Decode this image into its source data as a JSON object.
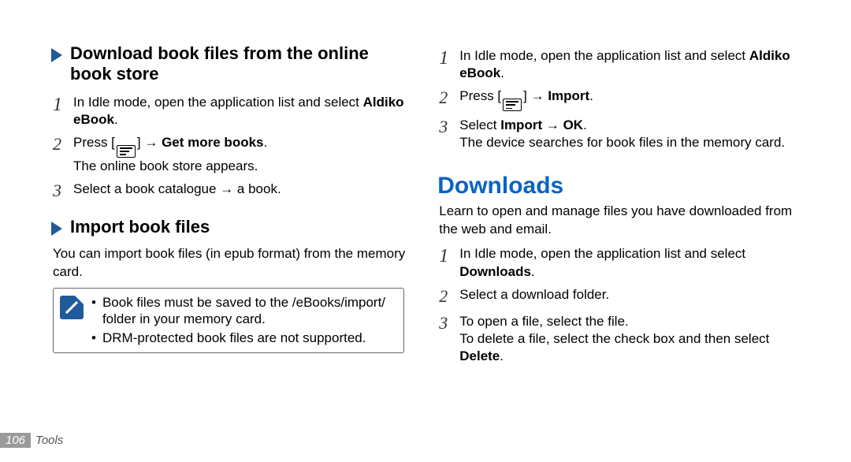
{
  "left": {
    "download": {
      "heading": "Download book files from the online book store",
      "steps": [
        {
          "pre": "In Idle mode, open the application list and select ",
          "bold": "Aldiko eBook",
          "post": "."
        },
        {
          "pre": "Press [",
          "icon": "menu",
          "mid": "] → ",
          "bold": "Get more books",
          "post": ".",
          "sub": "The online book store appears."
        },
        {
          "pre": "Select a book catalogue → a book."
        }
      ]
    },
    "import": {
      "heading": "Import book files",
      "intro": "You can import book files (in epub format) from the memory card.",
      "notes": [
        "Book files must be saved to the /eBooks/import/ folder in your memory card.",
        "DRM-protected book files are not supported."
      ]
    }
  },
  "right": {
    "first_steps": [
      {
        "pre": "In Idle mode, open the application list and select ",
        "bold": "Aldiko eBook",
        "post": "."
      },
      {
        "pre": "Press [",
        "icon": "menu",
        "mid": "] → ",
        "bold": "Import",
        "post": "."
      },
      {
        "pre": "Select ",
        "bold": "Import",
        "post1": " → ",
        "bold2": "OK",
        "post2": ".",
        "sub": "The device searches for book files in the memory card."
      }
    ],
    "downloads": {
      "title": "Downloads",
      "intro": "Learn to open and manage files you have downloaded from the web and email.",
      "steps": [
        {
          "pre": "In Idle mode, open the application list and select ",
          "bold": "Downloads",
          "post": "."
        },
        {
          "pre": "Select a download folder."
        },
        {
          "pre": "To open a file, select the file.",
          "sub_pre": "To delete a file, select the check box and then select ",
          "sub_bold": "Delete",
          "sub_post": "."
        }
      ]
    }
  },
  "footer": {
    "page_number": "106",
    "section": "Tools"
  }
}
